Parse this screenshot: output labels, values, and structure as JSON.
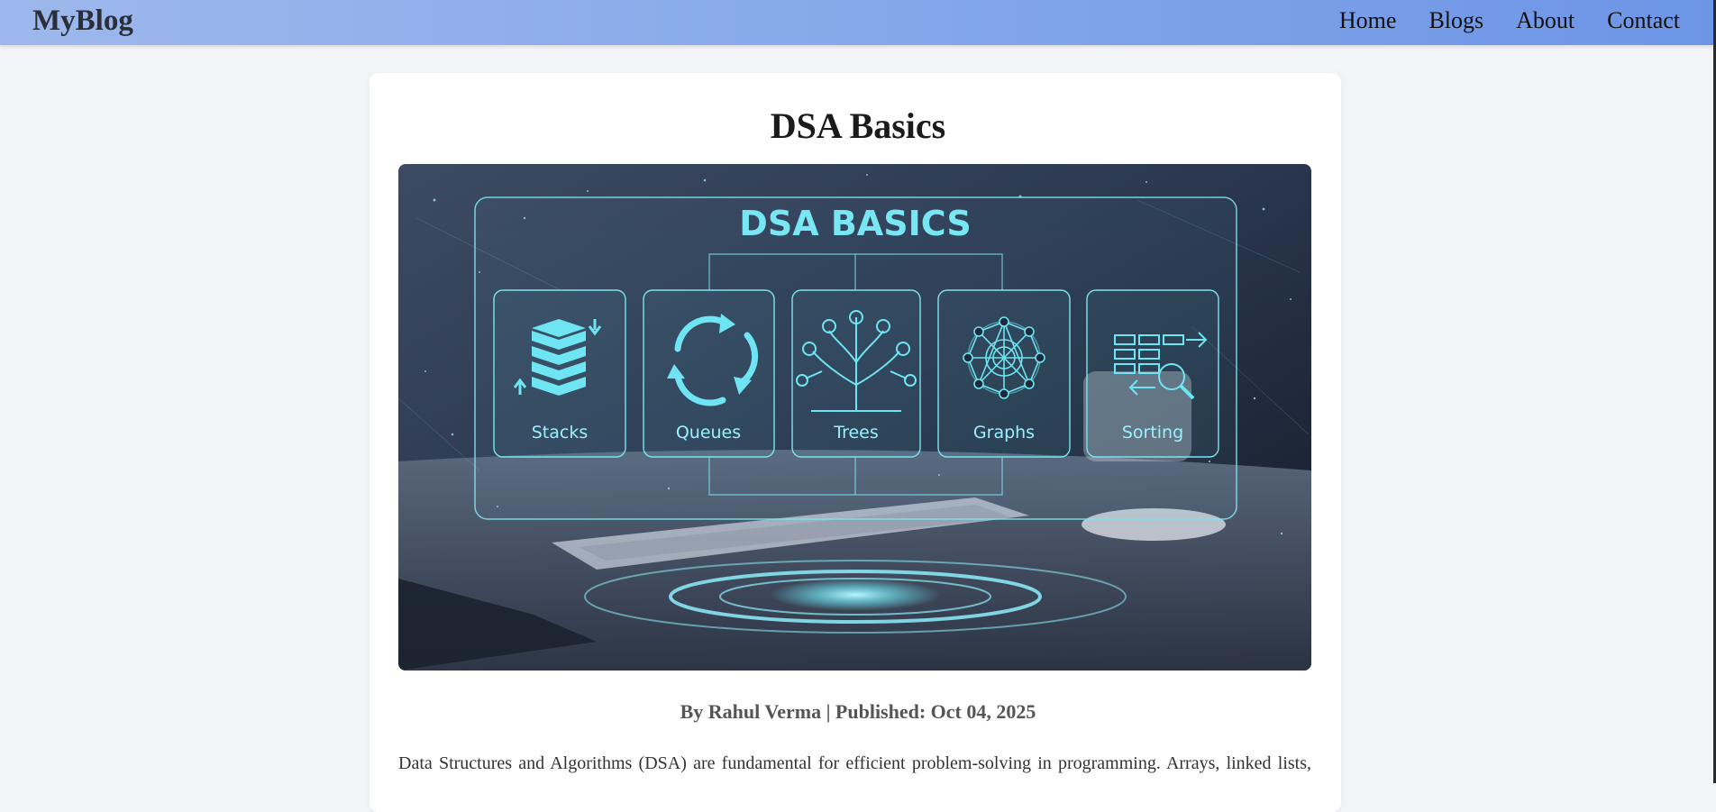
{
  "nav": {
    "brand": "MyBlog",
    "links": [
      "Home",
      "Blogs",
      "About",
      "Contact"
    ]
  },
  "post": {
    "title": "DSA Basics",
    "image": {
      "heading": "DSA BASICS",
      "topics": [
        "Stacks",
        "Queues",
        "Trees",
        "Graphs",
        "Sorting"
      ]
    },
    "meta": "By Rahul Verma | Published: Oct 04, 2025",
    "excerpt": "Data Structures and Algorithms (DSA) are fundamental for efficient problem-solving in programming. Arrays, linked lists,"
  },
  "colors": {
    "nav_gradient_start": "#9db8ec",
    "nav_gradient_end": "#6d95e6",
    "accent_cyan": "#6fe4f2",
    "page_bg": "#f3f5f8"
  }
}
